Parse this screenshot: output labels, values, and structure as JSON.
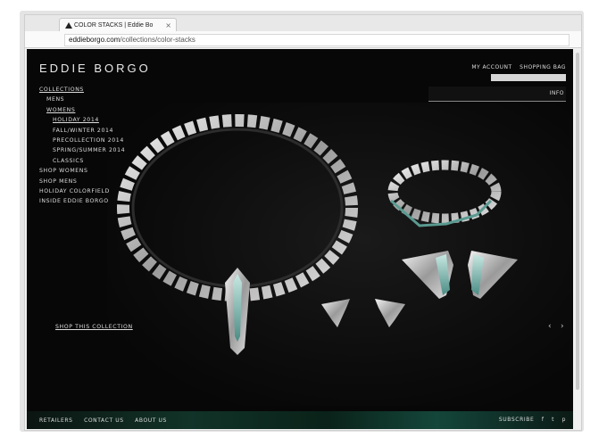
{
  "browser": {
    "tab_title": "COLOR STACKS | Eddie Bo",
    "tab_close": "×",
    "url_domain": "eddieborgo.com",
    "url_path": "/collections/color-stacks"
  },
  "header": {
    "logo": "EDDIE BORGO",
    "my_account": "MY ACCOUNT",
    "shopping_bag": "SHOPPING BAG",
    "info": "INFO"
  },
  "nav": {
    "collections": "COLLECTIONS",
    "mens": "MENS",
    "womens": "WOMENS",
    "holiday_2014": "HOLIDAY 2014",
    "fall_winter_2014": "FALL/WINTER 2014",
    "precollection_2014": "PRECOLLECTION 2014",
    "spring_summer_2014": "SPRING/SUMMER 2014",
    "classics": "CLASSICS",
    "shop_womens": "SHOP WOMENS",
    "shop_mens": "SHOP MENS",
    "holiday_colorfield": "HOLIDAY COLORFIELD",
    "inside_eddie_borgo": "INSIDE EDDIE BORGO"
  },
  "hero": {
    "shop_collection": "SHOP THIS COLLECTION",
    "prev_arrow": "‹",
    "next_arrow": "›"
  },
  "footer": {
    "retailers": "RETAILERS",
    "contact_us": "CONTACT US",
    "about_us": "ABOUT US",
    "subscribe": "SUBSCRIBE",
    "facebook": "f",
    "twitter": "t",
    "pinterest": "p"
  }
}
